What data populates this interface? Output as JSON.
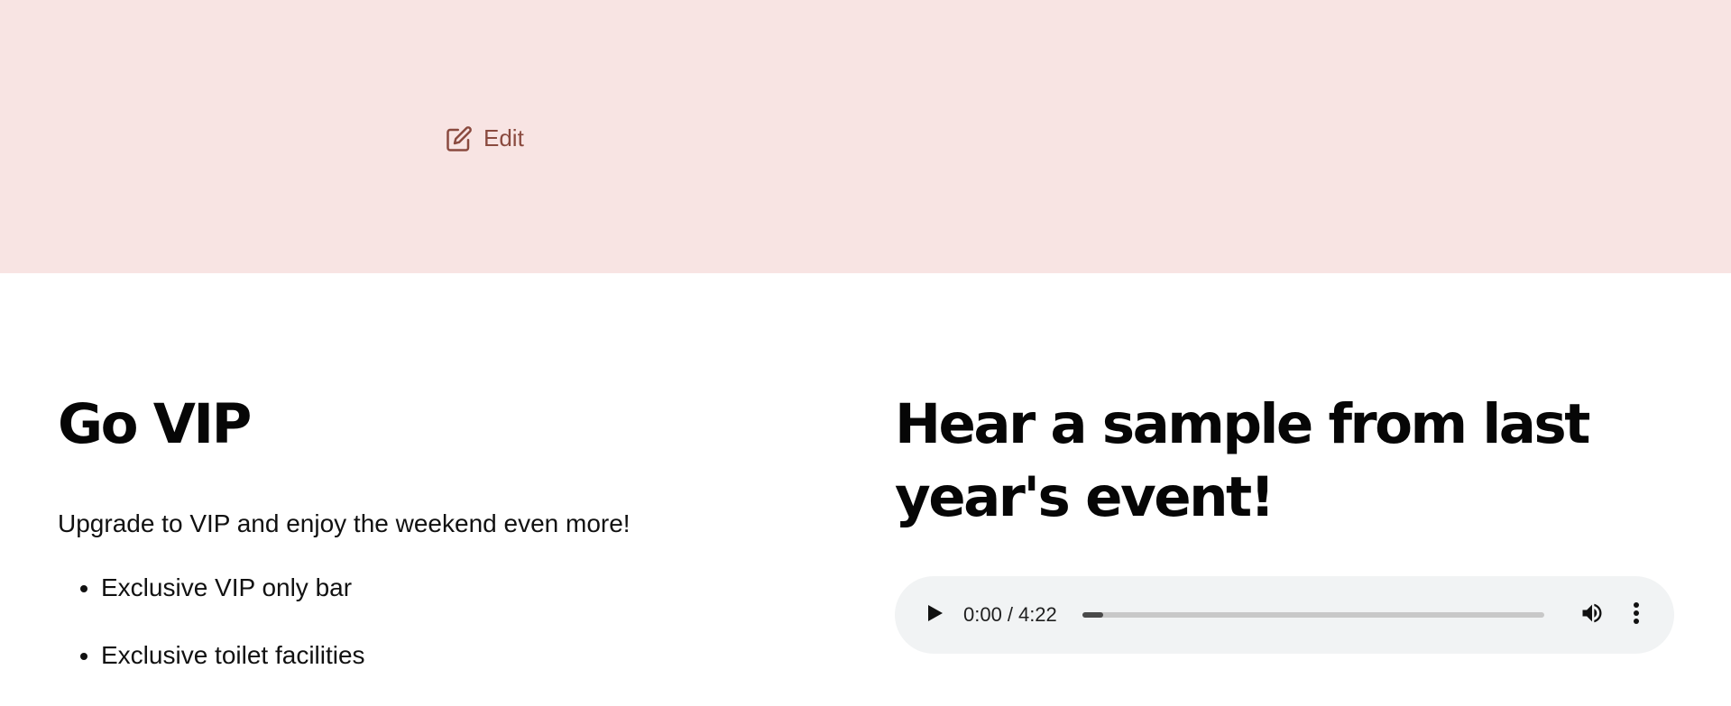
{
  "hero": {
    "edit_label": "Edit",
    "edit_icon": "pencil-square-icon",
    "background_color": "#f8e4e3",
    "link_color": "#8a4a3f"
  },
  "vip": {
    "title": "Go VIP",
    "lead": "Upgrade to VIP and enjoy the weekend even more!",
    "perks": [
      "Exclusive VIP only bar",
      "Exclusive toilet facilities"
    ]
  },
  "sample": {
    "title": "Hear a sample from last year's event!",
    "player": {
      "current_time": "0:00",
      "separator": "/",
      "duration": "4:22",
      "progress_fraction": 0.045,
      "play_icon": "play-icon",
      "volume_icon": "volume-icon",
      "more_icon": "more-options-icon",
      "background_color": "#f1f3f4"
    }
  }
}
